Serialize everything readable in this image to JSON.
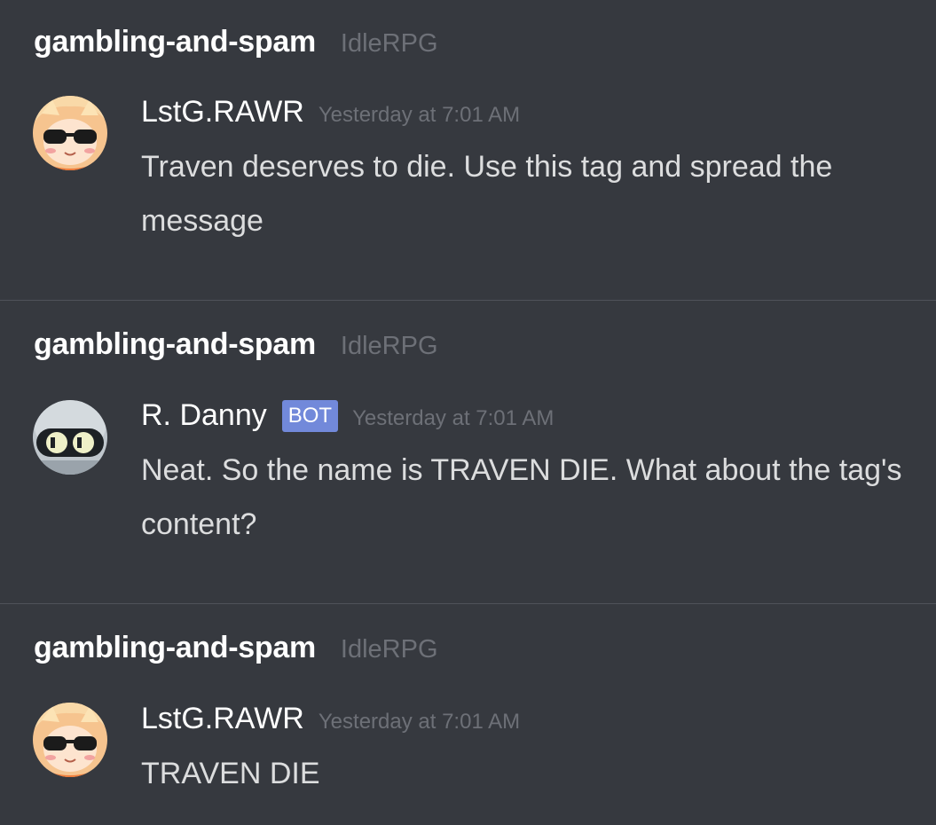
{
  "entries": [
    {
      "channel": "gambling-and-spam",
      "server": "IdleRPG",
      "author": "LstG.RAWR",
      "timestamp": "Yesterday at 7:01 AM",
      "text": "Traven deserves to die. Use this tag and spread the message",
      "avatar_icon": "sunglasses-character-avatar"
    },
    {
      "channel": "gambling-and-spam",
      "server": "IdleRPG",
      "author": "R. Danny",
      "tag": "BOT",
      "timestamp": "Yesterday at 7:01 AM",
      "text": "Neat. So the name is TRAVEN DIE. What about the tag's content?",
      "avatar_icon": "robot-eyes-avatar"
    },
    {
      "channel": "gambling-and-spam",
      "server": "IdleRPG",
      "author": "LstG.RAWR",
      "timestamp": "Yesterday at 7:01 AM",
      "text": "TRAVEN DIE",
      "avatar_icon": "sunglasses-character-avatar"
    }
  ],
  "colors": {
    "background": "#36393f",
    "bot_tag": "#7289da",
    "divider": "#4f525a"
  }
}
